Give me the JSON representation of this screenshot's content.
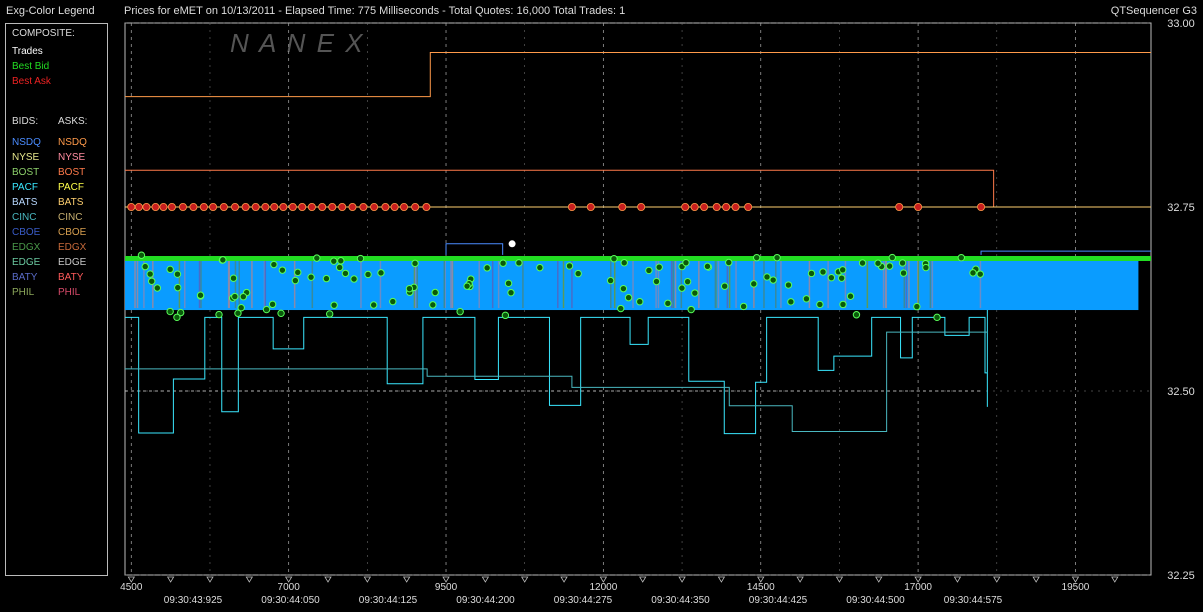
{
  "header": {
    "legend_title": "Exg-Color Legend",
    "chart_title": "Prices for  eMET  on  10/13/2011  -  Elapsed Time: 775 Milliseconds  -  Total Quotes: 16,000  Total Trades: 1",
    "app_name": "QTSequencer G3"
  },
  "legend": {
    "composite_heading": "COMPOSITE:",
    "composite": [
      {
        "label": "Trades",
        "color": "#ffffff"
      },
      {
        "label": "Best Bid",
        "color": "#22dd22"
      },
      {
        "label": "Best Ask",
        "color": "#ee2222"
      }
    ],
    "bids_heading": "BIDS:",
    "asks_heading": "ASKS:",
    "exchanges": [
      {
        "bid": "NSDQ",
        "bid_color": "#4a8cff",
        "ask": "NSDQ",
        "ask_color": "#ff9a4a"
      },
      {
        "bid": "NYSE",
        "bid_color": "#e6e68c",
        "ask": "NYSE",
        "ask_color": "#ff8ca0"
      },
      {
        "bid": "BOST",
        "bid_color": "#8ccf6a",
        "ask": "BOST",
        "ask_color": "#ff7a4a"
      },
      {
        "bid": "PACF",
        "bid_color": "#3ae8ff",
        "ask": "PACF",
        "ask_color": "#ffff4a"
      },
      {
        "bid": "BATS",
        "bid_color": "#b8d8ff",
        "ask": "BATS",
        "ask_color": "#ffd070"
      },
      {
        "bid": "CINC",
        "bid_color": "#4ab8c0",
        "ask": "CINC",
        "ask_color": "#c8b070"
      },
      {
        "bid": "CBOE",
        "bid_color": "#3a5cc8",
        "ask": "CBOE",
        "ask_color": "#d8a050"
      },
      {
        "bid": "EDGX",
        "bid_color": "#4a9a4a",
        "ask": "EDGX",
        "ask_color": "#c86a3a"
      },
      {
        "bid": "EDGE",
        "bid_color": "#6ac8a0",
        "ask": "EDGE",
        "ask_color": "#c8c8c8"
      },
      {
        "bid": "BATY",
        "bid_color": "#5a6cc8",
        "ask": "BATY",
        "ask_color": "#ff5a5a"
      },
      {
        "bid": "PHIL",
        "bid_color": "#8ca85a",
        "ask": "PHIL",
        "ask_color": "#d84a6a"
      }
    ]
  },
  "watermark": "N A N E X",
  "chart_data": {
    "type": "line",
    "title": "Prices for  eMET  on  10/13/2011",
    "xlabel": "",
    "ylabel": "",
    "xlim": [
      4400,
      20700
    ],
    "ylim": [
      32.25,
      33.0
    ],
    "x_ticks": [
      "4500",
      "7000",
      "9500",
      "12000",
      "14500",
      "17000",
      "19500"
    ],
    "y_ticks": [
      "33.00",
      "32.75",
      "32.50",
      "32.25"
    ],
    "y_tick_values": [
      33.0,
      32.75,
      32.5,
      32.25
    ],
    "time_labels": [
      "09:30:43:925",
      "09:30:44:050",
      "09:30:44:125",
      "09:30:44:200",
      "09:30:44:275",
      "09:30:44:350",
      "09:30:44:425",
      "09:30:44:500",
      "09:30:44:575"
    ],
    "grid": true,
    "dashed_levels": [
      32.5
    ],
    "series": [
      {
        "name": "Best Bid",
        "color": "#22dd22",
        "x": [
          4400,
          20700
        ],
        "y": [
          32.68,
          32.68
        ]
      },
      {
        "name": "Best Ask",
        "color": "#ee2222",
        "x": [
          4400,
          20700
        ],
        "y": [
          32.75,
          32.75
        ]
      }
    ],
    "ask_lines": [
      {
        "color": "#ff9a4a",
        "x": [
          4400,
          9250,
          9250,
          20700
        ],
        "y": [
          32.9,
          32.9,
          32.96,
          32.96
        ]
      },
      {
        "color": "#ff7a4a",
        "x": [
          4400,
          18200,
          18200
        ],
        "y": [
          32.8,
          32.8,
          32.75
        ]
      },
      {
        "color": "#ffd070",
        "x": [
          4400,
          20700
        ],
        "y": [
          32.75,
          32.75
        ]
      }
    ],
    "spread_band": {
      "from": 32.61,
      "to": 32.68,
      "x_end": 20500
    },
    "trades": [
      {
        "x": 10550,
        "y": 32.7
      }
    ]
  }
}
